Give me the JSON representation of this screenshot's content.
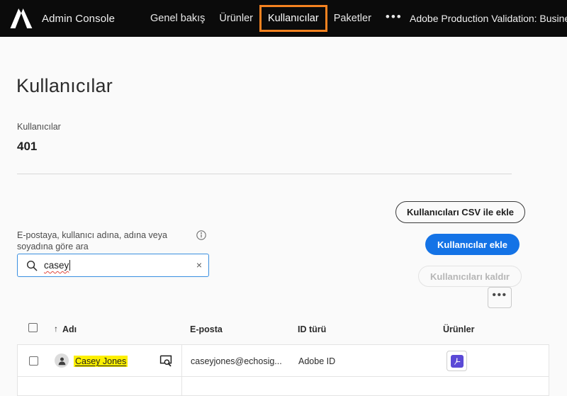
{
  "topnav": {
    "logo_icon": "adobe-logo-icon",
    "brand_title": "Admin Console",
    "items": [
      {
        "label": "Genel bakış",
        "icon": "",
        "active": false
      },
      {
        "label": "Ürünler",
        "icon": "",
        "active": false
      },
      {
        "label": "Kullanıcılar",
        "icon": "",
        "active": true
      },
      {
        "label": "Paketler",
        "icon": "",
        "active": false
      },
      {
        "label": "•••",
        "icon": "overflow-menu-icon",
        "active": false
      }
    ],
    "org_name": "Adobe Production Validation: BusinessTra",
    "highlight_color": "#f58220",
    "background_color": "#0b0b0b"
  },
  "page": {
    "title": "Kullanıcılar",
    "stat_label": "Kullanıcılar",
    "stat_value": "401"
  },
  "actions": {
    "csv_label": "Kullanıcıları CSV ile ekle",
    "add_label": "Kullanıcılar ekle",
    "remove_label": "Kullanıcıları kaldır",
    "more_label": "•••",
    "accent_color": "#1473e6",
    "disabled_color": "#b6b6b6"
  },
  "search": {
    "label": "E-postaya, kullanıcı adına, adına veya soyadına göre ara",
    "info_icon": "info-circle-icon",
    "search_icon": "search-icon",
    "value": "casey",
    "placeholder": "",
    "clear_icon": "×",
    "focus_color": "#3a8fe0"
  },
  "table": {
    "sort_arrow": "↑",
    "columns": [
      {
        "key": "name",
        "label": "Adı"
      },
      {
        "key": "email",
        "label": "E-posta"
      },
      {
        "key": "idtype",
        "label": "ID türü"
      },
      {
        "key": "products",
        "label": "Ürünler"
      }
    ],
    "rows": [
      {
        "name": "Casey Jones",
        "email": "caseyjones@echosig...",
        "idtype": "Adobe ID",
        "product_icon": "acrobat-icon",
        "product_color": "#5b4ad6",
        "name_highlight_color": "#fdf000",
        "avatar_icon": "user-avatar-icon",
        "detail_icon": "view-details-icon"
      }
    ]
  }
}
